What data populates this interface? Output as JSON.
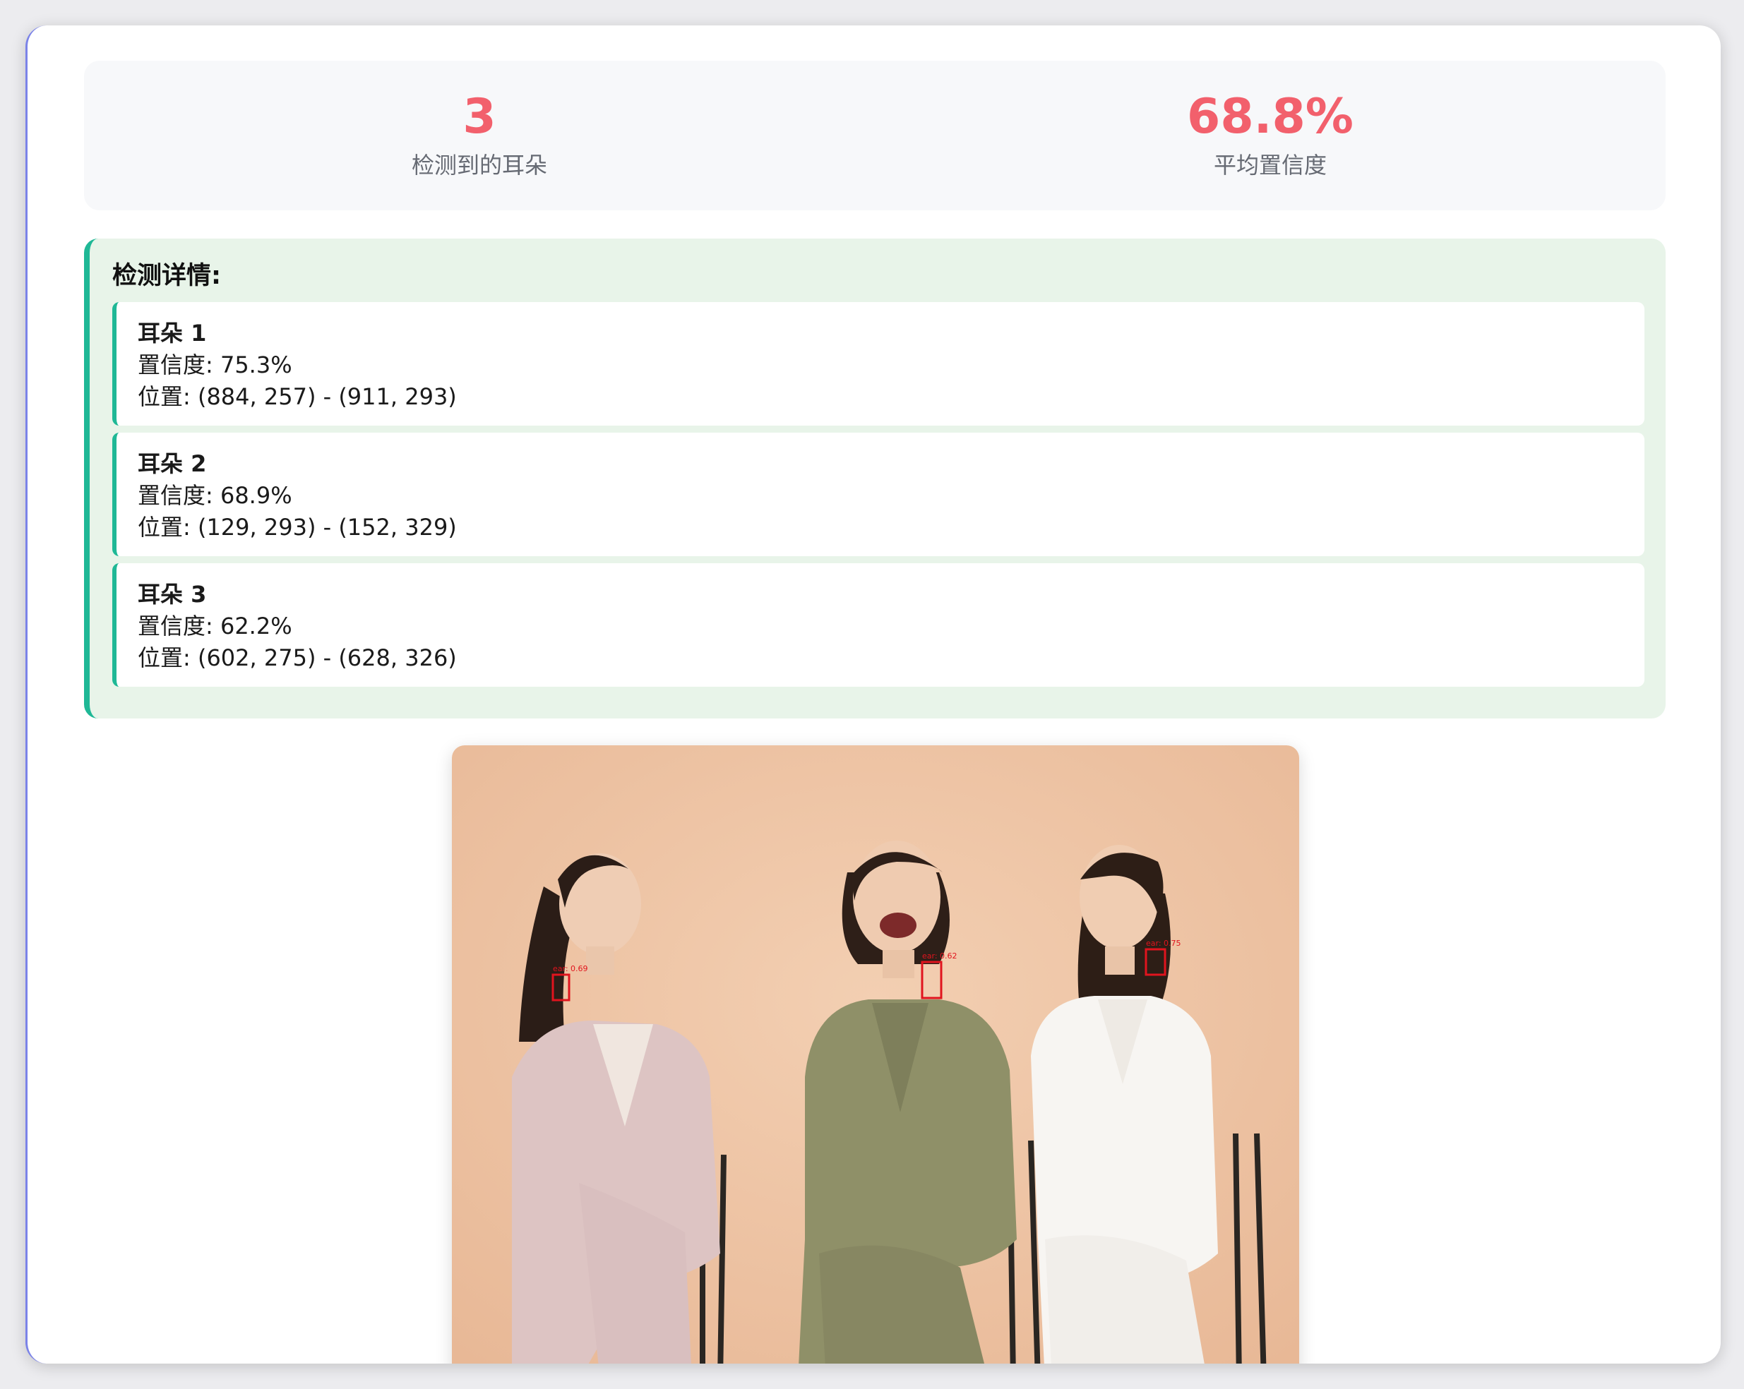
{
  "stats": {
    "ear_count": "3",
    "ear_count_label": "检测到的耳朵",
    "avg_confidence": "68.8%",
    "avg_confidence_label": "平均置信度"
  },
  "details": {
    "title": "检测详情:",
    "items": [
      {
        "title": "耳朵 1",
        "confidence": "置信度: 75.3%",
        "position": "位置: (884, 257) - (911, 293)"
      },
      {
        "title": "耳朵 2",
        "confidence": "置信度: 68.9%",
        "position": "位置: (129, 293) - (152, 329)"
      },
      {
        "title": "耳朵 3",
        "confidence": "置信度: 62.2%",
        "position": "位置: (602, 275) - (628, 326)"
      }
    ]
  },
  "image": {
    "box_labels": [
      "ear: 0.69",
      "ear: 0.62",
      "ear: 0.75"
    ],
    "colors": {
      "background": "#efc7a6",
      "box": "#e0141e"
    }
  }
}
